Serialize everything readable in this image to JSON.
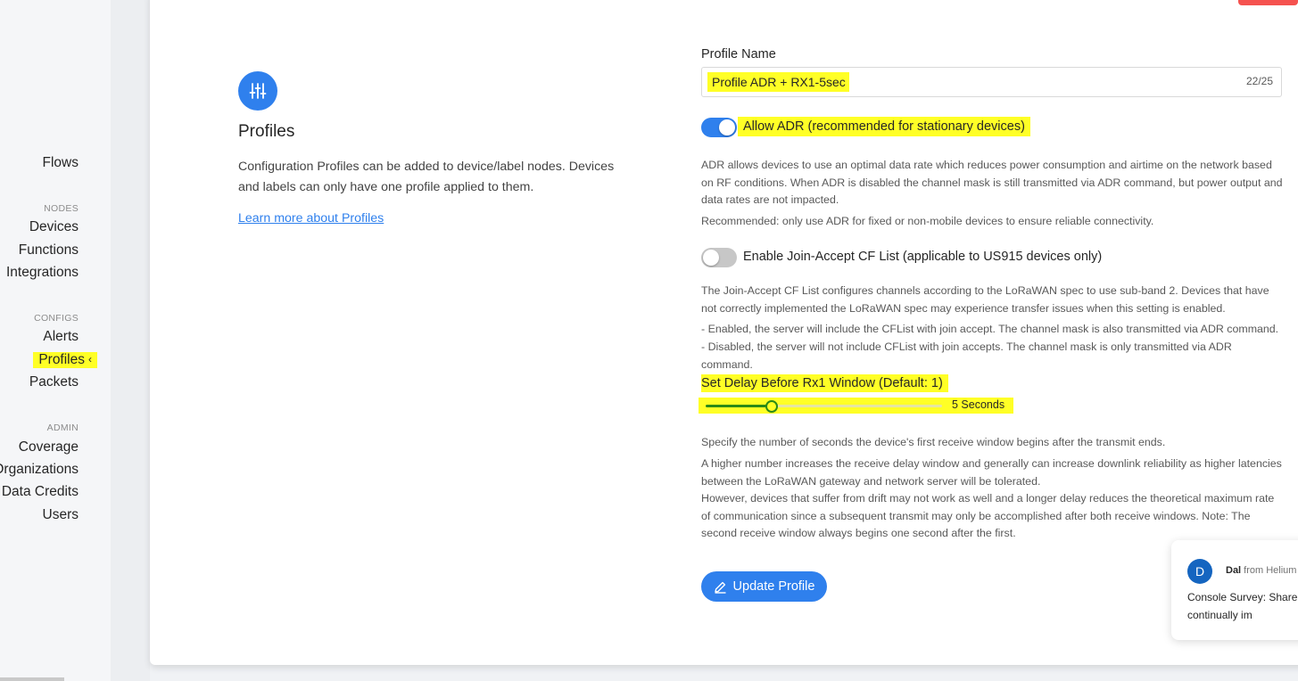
{
  "sidebar": {
    "items": [
      {
        "label": "Flows"
      },
      {
        "section": "NODES"
      },
      {
        "label": "Devices"
      },
      {
        "label": "Functions"
      },
      {
        "label": "Integrations"
      },
      {
        "section": "CONFIGS"
      },
      {
        "label": "Alerts"
      },
      {
        "label": "Profiles",
        "active": true
      },
      {
        "label": "Packets"
      },
      {
        "section": "ADMIN"
      },
      {
        "label": "Coverage"
      },
      {
        "label": "Organizations"
      },
      {
        "label": "Data Credits"
      },
      {
        "label": "Users"
      }
    ],
    "active_chevron": "‹"
  },
  "intro": {
    "icon": "sliders-icon",
    "title": "Profiles",
    "description": "Configuration Profiles can be added to device/label nodes. Devices and labels can only have one profile applied to them.",
    "learn_more": "Learn more about Profiles"
  },
  "form": {
    "profile_name_label": "Profile Name",
    "profile_name_value": "Profile ADR + RX1-5sec",
    "profile_name_count": "22/25",
    "adr": {
      "enabled": true,
      "label": "Allow ADR (recommended for stationary devices)",
      "help_1": "ADR allows devices to use an optimal data rate which reduces power consumption and airtime on the network based on RF conditions. When ADR is disabled the channel mask is still transmitted via ADR command, but power output and data rates are not impacted.",
      "help_2": "Recommended: only use ADR for fixed or non-mobile devices to ensure reliable connectivity."
    },
    "cf_list": {
      "enabled": false,
      "label": "Enable Join-Accept CF List (applicable to US915 devices only)",
      "help_1": "The Join-Accept CF List configures channels according to the LoRaWAN spec to use sub-band 2. Devices that have not correctly implemented the LoRaWAN spec may experience transfer issues when this setting is enabled.",
      "help_2": "- Enabled, the server will include the CFList with join accept. The channel mask is also transmitted via ADR command.",
      "help_3": "- Disabled, the server will not include CFList with join accepts. The channel mask is only transmitted via ADR command."
    },
    "rx1_delay": {
      "label": "Set Delay Before Rx1 Window (Default: 1)",
      "value": 5,
      "value_text": "5 Seconds",
      "help_1": "Specify the number of seconds the device's first receive window begins after the transmit ends.",
      "help_2": "A higher number increases the receive delay window and generally can increase downlink reliability as higher latencies between the LoRaWAN gateway and network server will be tolerated.",
      "help_3": "However, devices that suffer from drift may not work as well and a longer delay reduces the theoretical maximum rate of communication since a subsequent transmit may only be accomplished after both receive windows. Note: The second receive window always begins one second after the first."
    },
    "update_button": "Update Profile"
  },
  "chat": {
    "avatar_letter": "D",
    "sender": "Dal",
    "from_text": " from Helium",
    "message": "Console Survey: Share Swag To continually im"
  },
  "colors": {
    "accent": "#2f80ed",
    "highlight": "#ffff26",
    "slider": "#2b8a16",
    "danger": "#f5524f"
  }
}
